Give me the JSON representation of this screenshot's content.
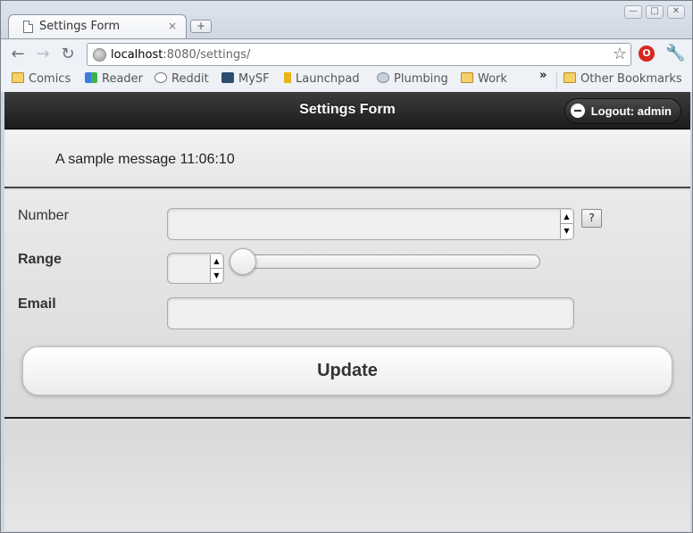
{
  "browser": {
    "tab_title": "Settings Form",
    "tab_close": "×",
    "new_tab": "+",
    "window_controls": {
      "minimize": "—",
      "maximize": "□",
      "close": "✕"
    },
    "nav": {
      "back": "←",
      "forward": "→",
      "reload": "↻"
    },
    "url_host": "localhost",
    "url_rest": ":8080/settings/",
    "bookmark_star": "☆",
    "wrench": "🔧",
    "bookmarks": [
      {
        "label": "Comics",
        "icon": "folder-icon"
      },
      {
        "label": "Reader",
        "icon": "google-reader-icon"
      },
      {
        "label": "Reddit",
        "icon": "reddit-icon"
      },
      {
        "label": "MySF",
        "icon": "sourceforge-icon"
      },
      {
        "label": "Launchpad",
        "icon": "launchpad-icon"
      },
      {
        "label": "Plumbing",
        "icon": "globe-icon"
      },
      {
        "label": "Work",
        "icon": "folder-icon"
      }
    ],
    "bookmarks_more": "»",
    "other_bookmarks": "Other Bookmarks"
  },
  "app": {
    "title": "Settings Form",
    "logout_label": "Logout: admin",
    "message": "A sample message 11:06:10"
  },
  "form": {
    "number_label": "Number",
    "number_value": "",
    "help_label": "?",
    "range_label": "Range",
    "range_value": "",
    "range_slider_fraction": 0,
    "email_label": "Email",
    "email_value": "",
    "submit_label": "Update"
  },
  "colors": {
    "header_bg": "#262626",
    "page_bg": "#dedede",
    "accent_opera": "#d8271c"
  }
}
